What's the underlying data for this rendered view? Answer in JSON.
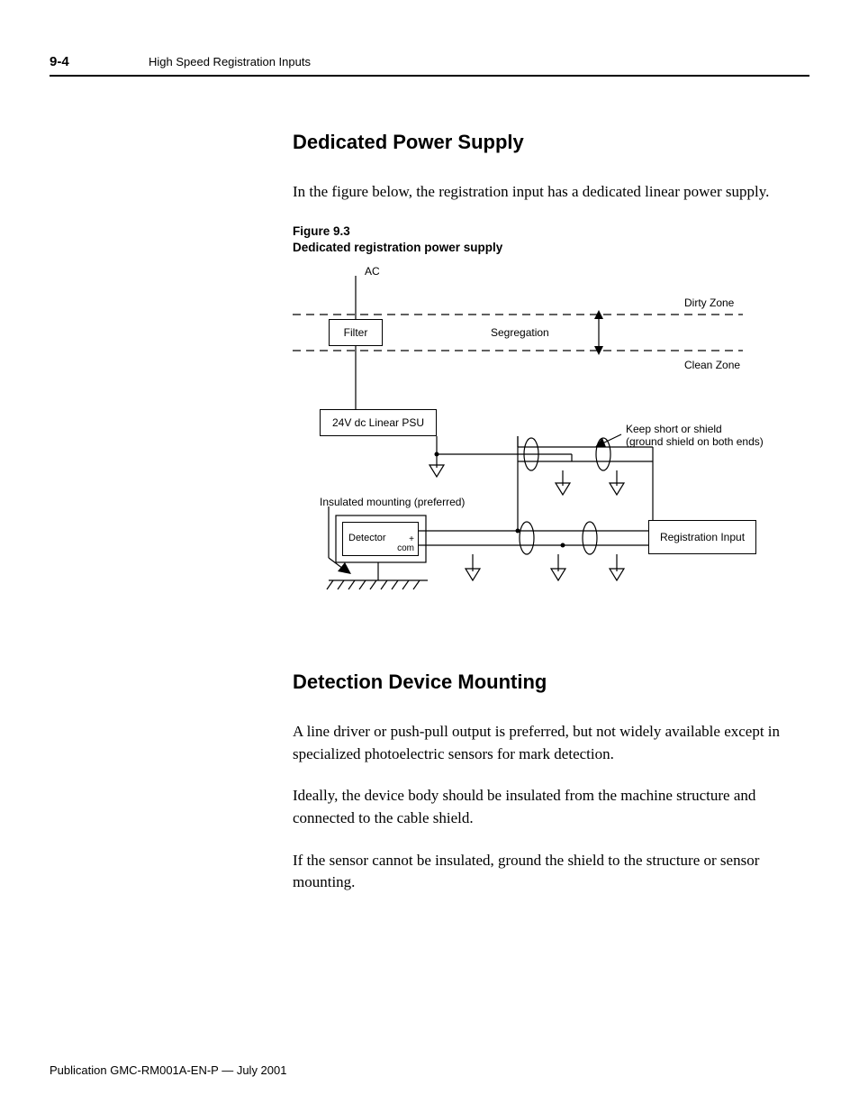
{
  "header": {
    "page_number": "9-4",
    "chapter_title": "High Speed Registration Inputs"
  },
  "section1": {
    "heading": "Dedicated Power Supply",
    "paragraph": "In the figure below, the registration input has a dedicated linear power supply."
  },
  "figure": {
    "label_line1": "Figure 9.3",
    "label_line2": "Dedicated registration power supply",
    "labels": {
      "ac": "AC",
      "filter": "Filter",
      "segregation": "Segregation",
      "dirty_zone": "Dirty Zone",
      "clean_zone": "Clean Zone",
      "psu": "24V dc Linear PSU",
      "keep_short_1": "Keep short or shield",
      "keep_short_2": "(ground shield on both ends)",
      "insulated": "Insulated mounting (preferred)",
      "detector": "Detector",
      "plus": "+",
      "com": "com",
      "reg_input": "Registration Input"
    }
  },
  "section2": {
    "heading": "Detection Device Mounting",
    "p1": "A line driver or push-pull output is preferred, but not widely available except in specialized photoelectric sensors for mark detection.",
    "p2": "Ideally, the device body should be insulated from the machine structure and connected to the cable shield.",
    "p3": "If the sensor cannot be insulated, ground the shield to the structure or sensor mounting."
  },
  "footer": "Publication GMC-RM001A-EN-P — July 2001"
}
